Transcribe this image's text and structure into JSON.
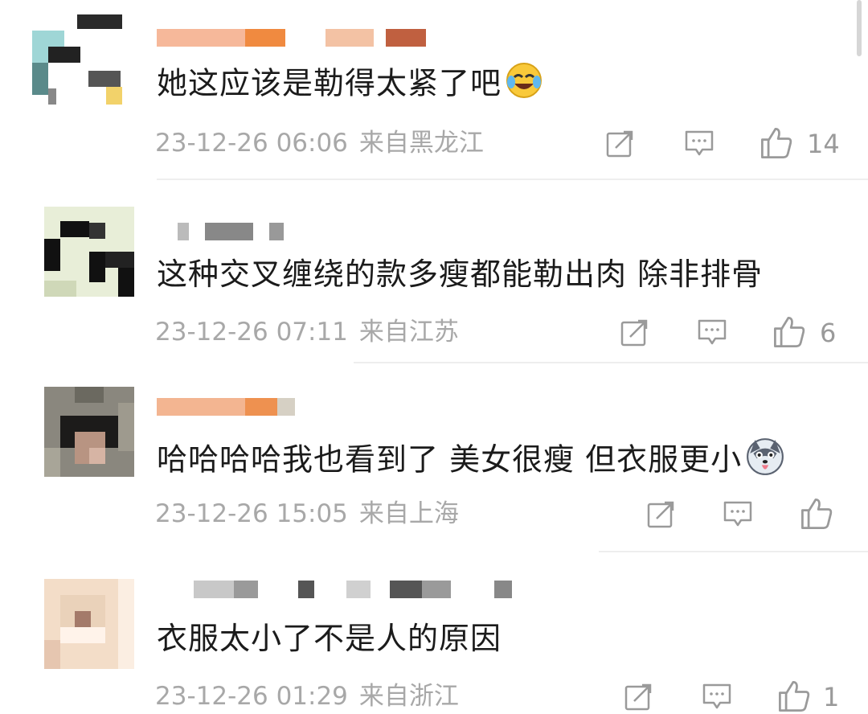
{
  "comments": [
    {
      "text": "她这应该是勒得太紧了吧",
      "emoji": "laughing-crying-emoji",
      "date": "23-12-26 06:06",
      "location": "来自黑龙江",
      "likes": "14"
    },
    {
      "text": "这种交叉缠绕的款多瘦都能勒出肉 除非排骨",
      "date": "23-12-26 07:11",
      "location": "来自江苏",
      "likes": "6"
    },
    {
      "text": "哈哈哈哈我也看到了 美女很瘦 但衣服更小",
      "emoji": "husky-dog-emoji",
      "date": "23-12-26 15:05",
      "location": "来自上海",
      "likes": ""
    },
    {
      "text": "衣服太小了不是人的原因",
      "date": "23-12-26 01:29",
      "location": "来自浙江",
      "likes": "1"
    }
  ],
  "icons": {
    "share": "share-icon",
    "reply": "comment-icon",
    "like": "thumbs-up-icon"
  },
  "colors": {
    "meta_text": "#a8a8a8",
    "icon": "#9a9a9a",
    "comment_text": "#1b1b1b"
  }
}
